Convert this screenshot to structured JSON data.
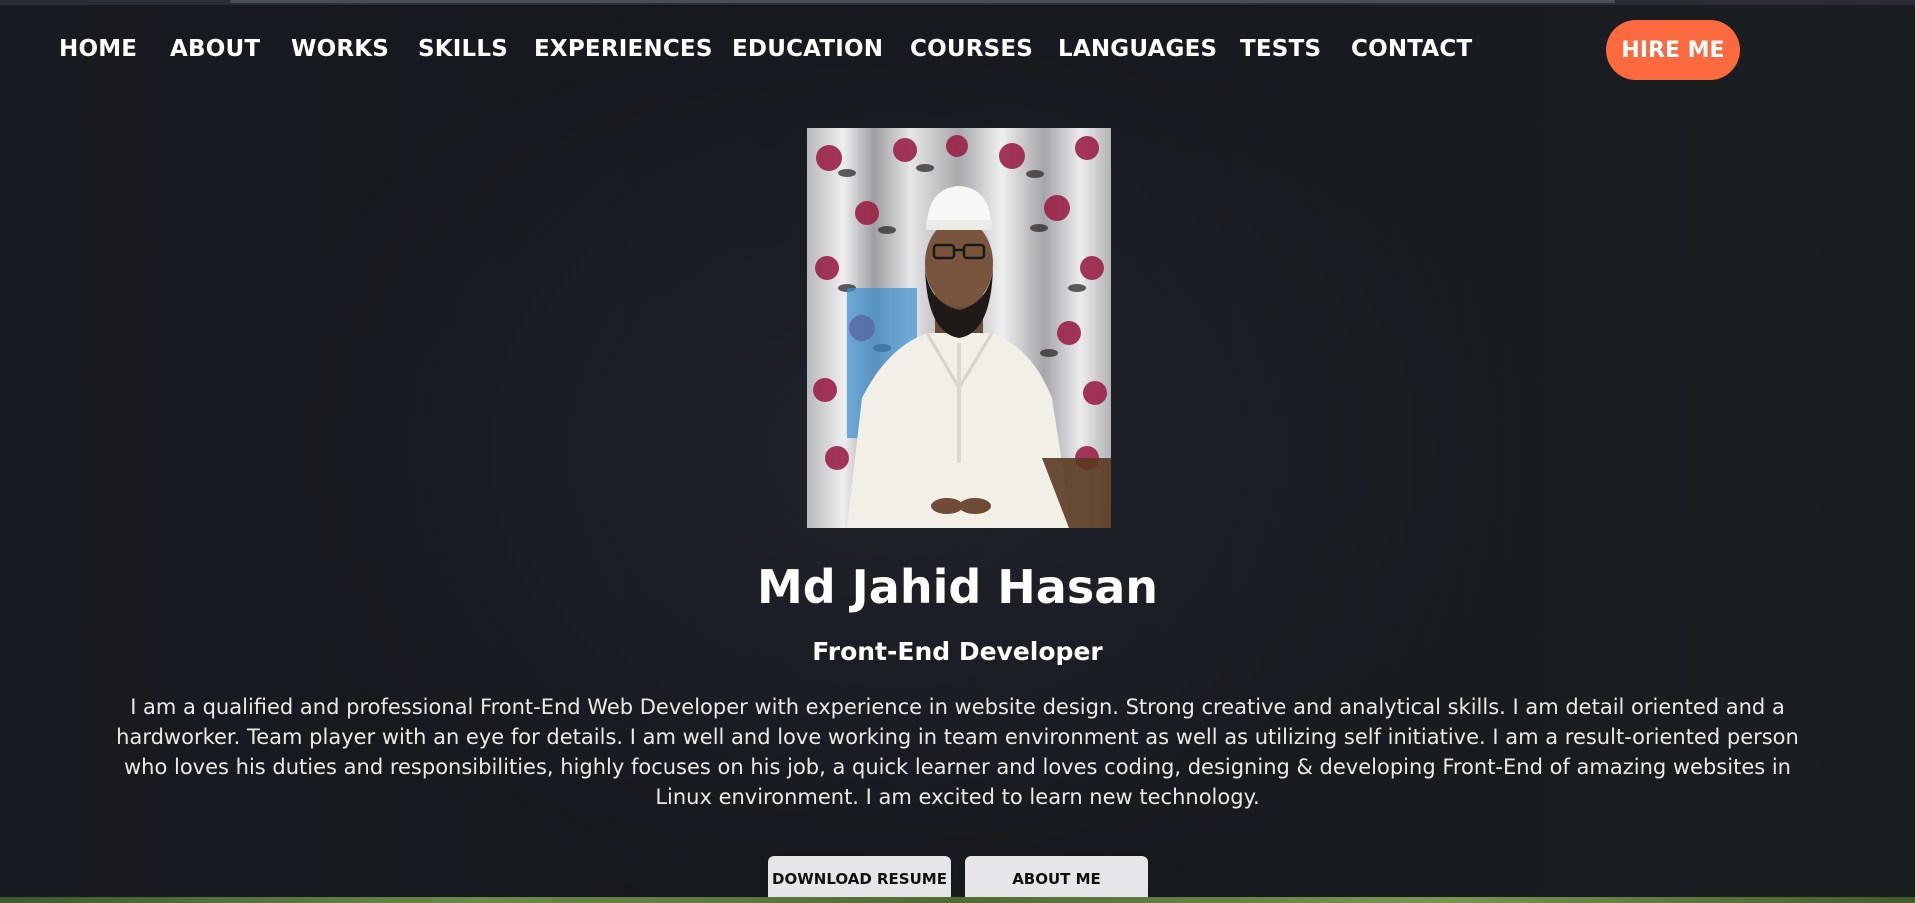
{
  "nav": {
    "items": [
      {
        "label": "HOME"
      },
      {
        "label": "ABOUT"
      },
      {
        "label": "WORKS"
      },
      {
        "label": "SKILLS"
      },
      {
        "label": "EXPERIENCES"
      },
      {
        "label": "EDUCATION"
      },
      {
        "label": "COURSES"
      },
      {
        "label": "LANGUAGES"
      },
      {
        "label": "TESTS"
      },
      {
        "label": "CONTACT"
      }
    ],
    "cta_label": "HIRE ME",
    "cta_color": "#fb6a3f"
  },
  "hero": {
    "name": "Md Jahid Hasan",
    "role": "Front-End Developer",
    "bio": "I am a qualified and professional Front-End Web Developer with experience in website design. Strong creative and analytical skills. I am detail oriented and a hardworker. Team player with an eye for details. I am well and love working in team environment as well as utilizing self initiative. I am a result-oriented person who loves his duties and responsibilities, highly focuses on his job, a quick learner and loves coding, designing & developing Front-End of amazing websites in Linux environment. I am excited to learn new technology.",
    "buttons": {
      "download_label": "DOWNLOAD RESUME",
      "about_label": "ABOUT ME"
    }
  },
  "colors": {
    "background": "#14171c",
    "accent": "#fb6a3f",
    "button_bg": "#e6e6ea"
  }
}
